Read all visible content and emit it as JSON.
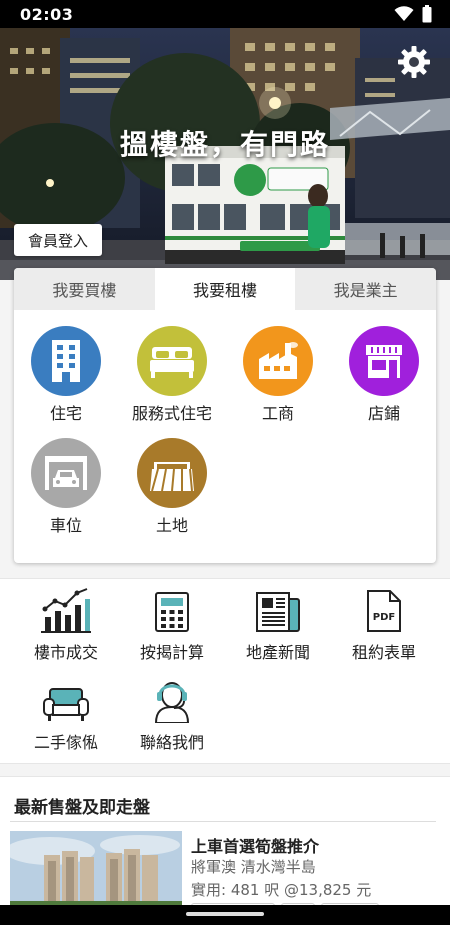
{
  "status_bar": {
    "time": "02:03",
    "icons": [
      "wifi-icon",
      "battery-icon"
    ]
  },
  "hero": {
    "slogan": "搵樓盤，有門路",
    "login_label": "會員登入",
    "settings_icon": "gear-icon"
  },
  "tabs": [
    {
      "label": "我要買樓",
      "active": false
    },
    {
      "label": "我要租樓",
      "active": true
    },
    {
      "label": "我是業主",
      "active": false
    }
  ],
  "categories": [
    {
      "label": "住宅",
      "icon": "building-icon",
      "color": "#3a7dc0"
    },
    {
      "label": "服務式住宅",
      "icon": "bed-icon",
      "color": "#c2c03a"
    },
    {
      "label": "工商",
      "icon": "factory-icon",
      "color": "#f2961c"
    },
    {
      "label": "店鋪",
      "icon": "storefront-icon",
      "color": "#a020dc"
    },
    {
      "label": "車位",
      "icon": "car-park-icon",
      "color": "#a8a8a8"
    },
    {
      "label": "土地",
      "icon": "land-icon",
      "color": "#a87a2a"
    }
  ],
  "tools": [
    {
      "label": "樓市成交",
      "icon": "bar-chart-icon"
    },
    {
      "label": "按揭計算",
      "icon": "calculator-icon"
    },
    {
      "label": "地產新聞",
      "icon": "newspaper-icon"
    },
    {
      "label": "租約表單",
      "icon": "pdf-icon",
      "badge": "PDF"
    },
    {
      "label": "二手傢俬",
      "icon": "sofa-icon"
    },
    {
      "label": "聯絡我們",
      "icon": "headset-icon"
    }
  ],
  "listings_section": {
    "title": "最新售盤及即走盤",
    "items": [
      {
        "title": "上車首選筍盤推介",
        "location": "將軍澳 清水灣半島",
        "price": "實用: 481 呎   @13,825 元"
      }
    ]
  }
}
